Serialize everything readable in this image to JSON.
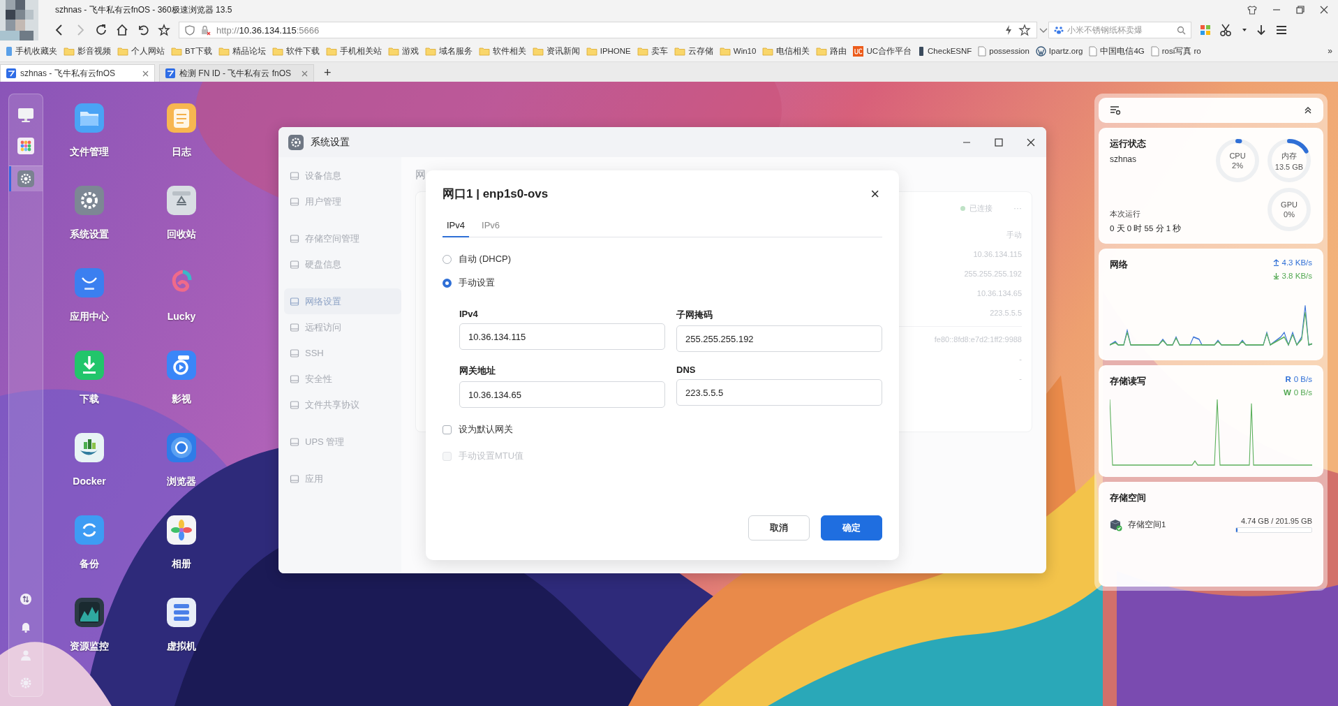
{
  "browser": {
    "title": "szhnas - 飞牛私有云fnOS - 360极速浏览器 13.5",
    "url": {
      "scheme": "http://",
      "host": "10.36.134.115",
      "port": ":5666"
    },
    "search": {
      "placeholder": "小米不锈钢纸杯卖爆"
    },
    "bookmarks": [
      {
        "label": "手机收藏夹",
        "kind": "phone"
      },
      {
        "label": "影音视频",
        "kind": "folder"
      },
      {
        "label": "个人网站",
        "kind": "folder"
      },
      {
        "label": "BT下载",
        "kind": "folder"
      },
      {
        "label": "精品论坛",
        "kind": "folder"
      },
      {
        "label": "软件下载",
        "kind": "folder"
      },
      {
        "label": "手机相关站",
        "kind": "folder"
      },
      {
        "label": "游戏",
        "kind": "folder"
      },
      {
        "label": "域名服务",
        "kind": "folder"
      },
      {
        "label": "软件相关",
        "kind": "folder"
      },
      {
        "label": "资讯新闻",
        "kind": "folder"
      },
      {
        "label": "IPHONE",
        "kind": "folder"
      },
      {
        "label": "卖车",
        "kind": "folder"
      },
      {
        "label": "云存储",
        "kind": "folder"
      },
      {
        "label": "Win10",
        "kind": "folder"
      },
      {
        "label": "电信相关",
        "kind": "folder"
      },
      {
        "label": "路由",
        "kind": "folder"
      },
      {
        "label": "UC合作平台",
        "kind": "uc"
      },
      {
        "label": "CheckESNF",
        "kind": "device"
      },
      {
        "label": "possession",
        "kind": "page"
      },
      {
        "label": "Ipartz.org",
        "kind": "wp"
      },
      {
        "label": "中国电信4G",
        "kind": "page"
      },
      {
        "label": "rosi写真 ro",
        "kind": "page"
      }
    ],
    "bookmarks_more": "»",
    "tabs": [
      {
        "title": "szhnas - 飞牛私有云fnOS",
        "selected": true
      },
      {
        "title": "检测 FN ID - 飞牛私有云 fnOS",
        "selected": false
      }
    ],
    "new_tab": "+"
  },
  "dock": {
    "items": [
      {
        "selected": false
      },
      {
        "selected": false
      },
      {
        "selected": true
      }
    ]
  },
  "desktop": {
    "apps": [
      {
        "label": "文件管理"
      },
      {
        "label": "日志"
      },
      {
        "label": "系统设置"
      },
      {
        "label": "回收站"
      },
      {
        "label": "应用中心"
      },
      {
        "label": "Lucky"
      },
      {
        "label": "下载"
      },
      {
        "label": "影视"
      },
      {
        "label": "Docker"
      },
      {
        "label": "浏览器"
      },
      {
        "label": "备份"
      },
      {
        "label": "相册"
      },
      {
        "label": "资源监控"
      },
      {
        "label": "虚拟机"
      }
    ]
  },
  "window": {
    "title": "系统设置",
    "sidebar": {
      "groups": [
        {
          "items": [
            {
              "label": "设备信息",
              "selected": false
            },
            {
              "label": "用户管理",
              "selected": false
            }
          ]
        },
        {
          "items": [
            {
              "label": "存储空间管理",
              "selected": false
            },
            {
              "label": "硬盘信息",
              "selected": false
            }
          ]
        },
        {
          "items": [
            {
              "label": "网络设置",
              "selected": true
            },
            {
              "label": "远程访问",
              "selected": false
            },
            {
              "label": "SSH",
              "selected": false
            },
            {
              "label": "安全性",
              "selected": false
            },
            {
              "label": "文件共享协议",
              "selected": false
            }
          ]
        },
        {
          "items": [
            {
              "label": "UPS 管理",
              "selected": false
            }
          ]
        },
        {
          "items": [
            {
              "label": "应用",
              "selected": false
            }
          ]
        }
      ]
    },
    "page": {
      "heading": "网",
      "card": {
        "status": "已连接",
        "more": "···",
        "values": [
          "手动",
          "10.36.134.115",
          "255.255.255.192",
          "10.36.134.65",
          "223.5.5.5"
        ],
        "ipv6_values": [
          "fe80::8fd8:e7d2:1ff2:9988",
          "-",
          "-"
        ]
      }
    }
  },
  "dialog": {
    "title": "网口1 | enp1s0-ovs",
    "close": "×",
    "tabs": [
      {
        "label": "IPv4",
        "selected": true
      },
      {
        "label": "IPv6",
        "selected": false
      }
    ],
    "modes": [
      {
        "label": "自动 (DHCP)",
        "selected": false
      },
      {
        "label": "手动设置",
        "selected": true
      }
    ],
    "fields": [
      {
        "label": "IPv4",
        "value": "10.36.134.115"
      },
      {
        "label": "子网掩码",
        "value": "255.255.255.192"
      },
      {
        "label": "网关地址",
        "value": "10.36.134.65"
      },
      {
        "label": "DNS",
        "value": "223.5.5.5"
      }
    ],
    "options": [
      {
        "label": "设为默认网关",
        "checked": false,
        "disabled": false
      },
      {
        "label": "手动设置MTU值",
        "checked": false,
        "disabled": true
      }
    ],
    "buttons": [
      {
        "label": "取消",
        "kind": "secondary"
      },
      {
        "label": "确定",
        "kind": "primary"
      }
    ]
  },
  "panel": {
    "status": {
      "title": "运行状态",
      "host": "szhnas",
      "uptime_label": "本次运行",
      "uptime": "0 天 0 时 55 分 1 秒",
      "gauges": [
        {
          "label": "CPU",
          "value": "2%",
          "level": 0.02
        },
        {
          "label": "内存",
          "value": "13.5 GB",
          "level": 0.17
        },
        {
          "label": "GPU",
          "value": "0%",
          "level": 0
        }
      ]
    },
    "network": {
      "title": "网络",
      "up": "4.3 KB/s",
      "down": "3.8 KB/s"
    },
    "disk_io": {
      "title": "存储读写",
      "read_label": "R",
      "read": "0 B/s",
      "write_label": "W",
      "write": "0 B/s"
    },
    "storage": {
      "title": "存储空间",
      "volumes": [
        {
          "name": "存储空间1",
          "usage": "4.74 GB / 201.95 GB",
          "level": 0.023
        }
      ]
    }
  }
}
